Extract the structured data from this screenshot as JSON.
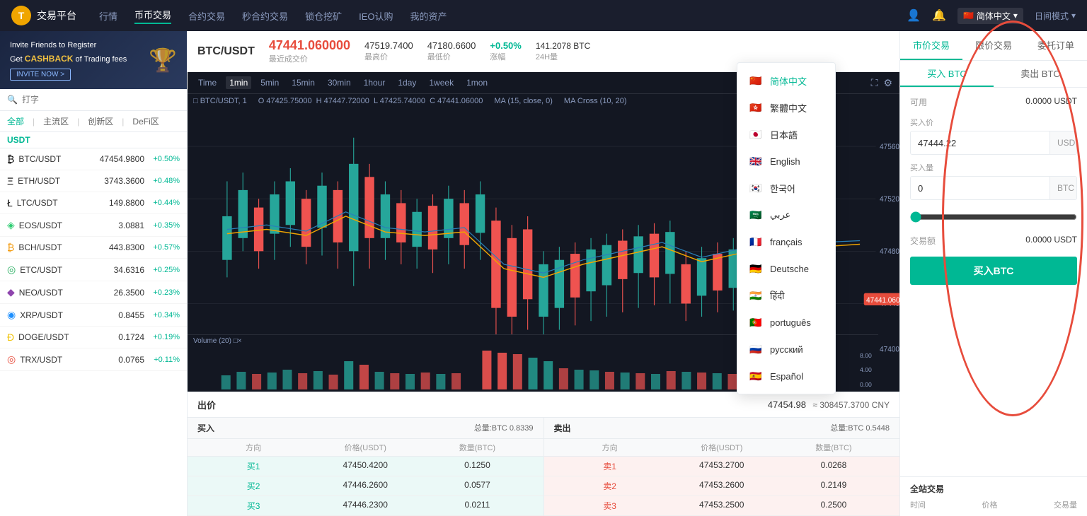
{
  "app": {
    "title": "交易平台",
    "logo_char": "T"
  },
  "nav": {
    "items": [
      {
        "label": "行情",
        "active": false
      },
      {
        "label": "币币交易",
        "active": true
      },
      {
        "label": "合约交易",
        "active": false
      },
      {
        "label": "秒合约交易",
        "active": false
      },
      {
        "label": "锁仓挖矿",
        "active": false
      },
      {
        "label": "IEO认购",
        "active": false
      },
      {
        "label": "我的资产",
        "active": false
      }
    ],
    "lang_label": "简体中文",
    "mode_label": "日间模式"
  },
  "invite": {
    "line1": "Invite Friends to Register",
    "line2": "Get",
    "cashback": "CASHBACK",
    "line3": "of Trading fees",
    "btn_label": "INVITE NOW >"
  },
  "search": {
    "placeholder": "打字"
  },
  "market_tabs": {
    "tabs": [
      "全部",
      "主流区",
      "创新区",
      "DeFi区"
    ],
    "active": "全部",
    "base": "USDT"
  },
  "coin_list": [
    {
      "name": "BTC/USDT",
      "price": "47454.9800",
      "change": "+0.50%",
      "up": true
    },
    {
      "name": "ETH/USDT",
      "price": "3743.3600",
      "change": "+0.48%",
      "up": true
    },
    {
      "name": "LTC/USDT",
      "price": "149.8800",
      "change": "+0.44%",
      "up": true
    },
    {
      "name": "EOS/USDT",
      "price": "3.0881",
      "change": "+0.35%",
      "up": true
    },
    {
      "name": "BCH/USDT",
      "price": "443.8300",
      "change": "+0.57%",
      "up": true
    },
    {
      "name": "ETC/USDT",
      "price": "34.6316",
      "change": "+0.25%",
      "up": true
    },
    {
      "name": "NEO/USDT",
      "price": "26.3500",
      "change": "+0.23%",
      "up": true
    },
    {
      "name": "XRP/USDT",
      "price": "0.8455",
      "change": "+0.34%",
      "up": true
    },
    {
      "name": "DOGE/USDT",
      "price": "0.1724",
      "change": "+0.19%",
      "up": true
    },
    {
      "name": "TRX/USDT",
      "price": "0.0765",
      "change": "+0.11%",
      "up": true
    }
  ],
  "chart_header": {
    "pair": "BTC/USDT",
    "price_main": "47441.060000",
    "price_sub": "最近成交价",
    "high_label": "最高价",
    "high_val": "47519.7400",
    "low_label": "最低价",
    "low_val": "47180.6600",
    "change_label": "涨幅",
    "change_val": "+0.50%",
    "vol_label": "24H量",
    "vol_val": "141.2078 BTC"
  },
  "chart_timeframes": [
    "Time",
    "1min",
    "5min",
    "15min",
    "30min",
    "1hour",
    "1day",
    "1week",
    "1mon"
  ],
  "chart_active_tf": "1min",
  "chart_info": {
    "pair_tf": "□ BTC/USDT, 1",
    "ohlc": "O 47425.75000  H 47447.72000  L 47425.74000  C 47441.06000",
    "ma": "MA (15, close, 0)",
    "ma_cross": "MA Cross (10, 20)"
  },
  "trade_tabs": [
    "市价交易",
    "限价交易",
    "委托订单"
  ],
  "buy_sell_tabs": [
    "买入 BTC",
    "卖出 BTC"
  ],
  "trade_form": {
    "available_label": "可用",
    "available_val": "0.0000 USDT",
    "buy_price_label": "买入价",
    "buy_price_val": "47444.22",
    "buy_price_unit": "USDT",
    "buy_qty_label": "买入量",
    "buy_qty_val": "0",
    "buy_qty_unit": "BTC",
    "total_label": "交易额",
    "total_val": "0.0000 USDT",
    "buy_btn": "买入BTC"
  },
  "all_trades": {
    "title": "全站交易",
    "cols": [
      "时间",
      "价格",
      "交易量"
    ]
  },
  "bid_section": {
    "title": "出价",
    "price": "47454.98",
    "approx": "≈ 308457.3700 CNY"
  },
  "buy_orders": {
    "title": "买入",
    "total": "总量:BTC 0.8339",
    "cols": [
      "方向",
      "价格(USDT)",
      "数量(BTC)"
    ],
    "rows": [
      {
        "dir": "买1",
        "price": "47450.4200",
        "qty": "0.1250"
      },
      {
        "dir": "买2",
        "price": "47446.2600",
        "qty": "0.0577"
      },
      {
        "dir": "买3",
        "price": "47446.2300",
        "qty": "0.0211"
      }
    ]
  },
  "sell_orders": {
    "title": "卖出",
    "total": "总量:BTC 0.5448",
    "cols": [
      "方向",
      "价格(USDT)",
      "数量(BTC)"
    ],
    "rows": [
      {
        "dir": "卖1",
        "price": "47453.2700",
        "qty": "0.0268"
      },
      {
        "dir": "卖2",
        "price": "47453.2600",
        "qty": "0.2149"
      },
      {
        "dir": "卖3",
        "price": "47453.2500",
        "qty": "0.2500"
      }
    ]
  },
  "language_dropdown": {
    "options": [
      {
        "label": "简体中文",
        "flag": "🇨🇳",
        "selected": true
      },
      {
        "label": "繁體中文",
        "flag": "🇭🇰",
        "selected": false
      },
      {
        "label": "日本語",
        "flag": "🇯🇵",
        "selected": false
      },
      {
        "label": "English",
        "flag": "🇬🇧",
        "selected": false
      },
      {
        "label": "한국어",
        "flag": "🇰🇷",
        "selected": false
      },
      {
        "label": "عربي",
        "flag": "🇸🇦",
        "selected": false
      },
      {
        "label": "français",
        "flag": "🇫🇷",
        "selected": false
      },
      {
        "label": "Deutsche",
        "flag": "🇩🇪",
        "selected": false
      },
      {
        "label": "हिंदी",
        "flag": "🇮🇳",
        "selected": false
      },
      {
        "label": "português",
        "flag": "🇵🇹",
        "selected": false
      },
      {
        "label": "русский",
        "flag": "🇷🇺",
        "selected": false
      },
      {
        "label": "Español",
        "flag": "🇪🇸",
        "selected": false
      }
    ]
  }
}
